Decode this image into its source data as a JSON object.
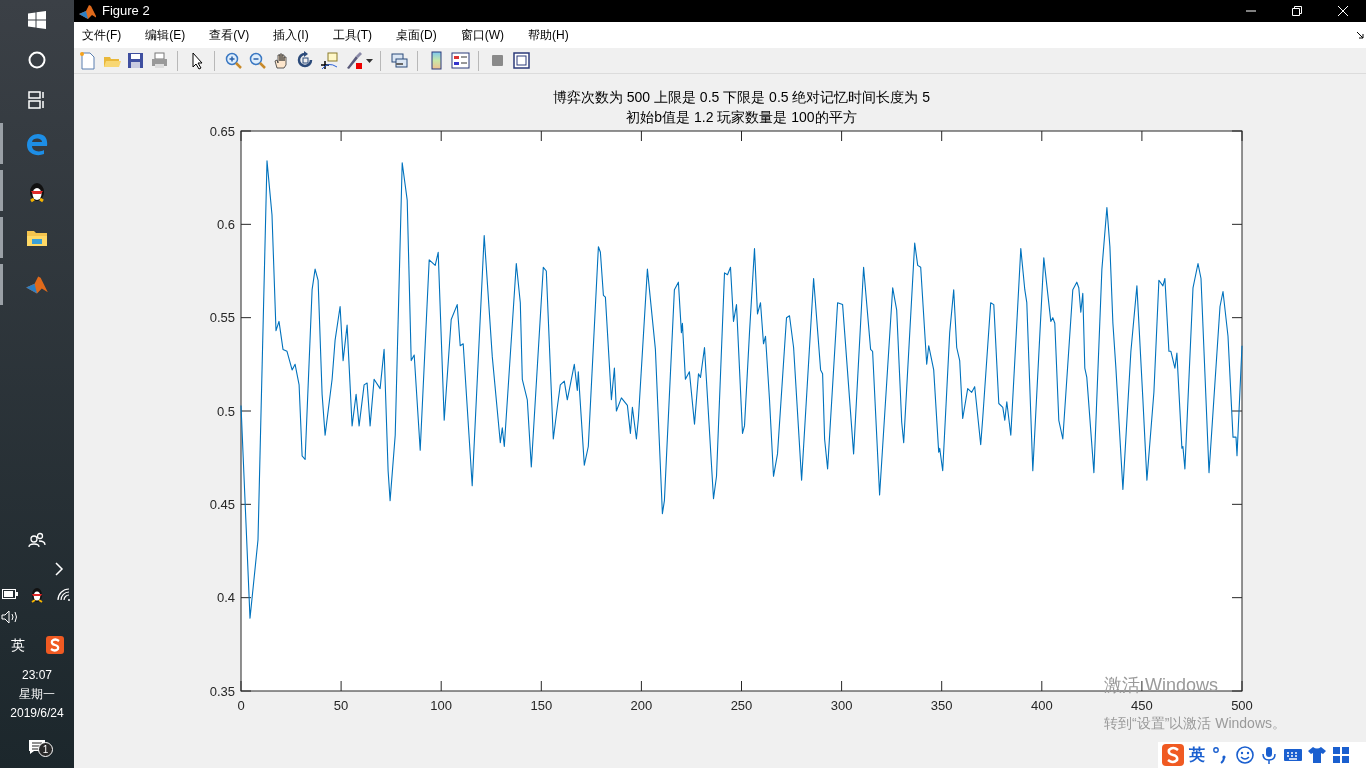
{
  "taskbar": {
    "pinned": [
      {
        "running": true
      },
      {
        "running": true
      },
      {
        "running": true
      },
      {
        "running": true
      }
    ],
    "ime": "英",
    "clock": {
      "time": "23:07",
      "weekday": "星期一",
      "date": "2019/6/24"
    },
    "notification_count": "1"
  },
  "window": {
    "title": "Figure 2",
    "menu": [
      "文件(F)",
      "编辑(E)",
      "查看(V)",
      "插入(I)",
      "工具(T)",
      "桌面(D)",
      "窗口(W)",
      "帮助(H)"
    ]
  },
  "figure": {
    "chart_data": {
      "type": "line",
      "title": "博弈次数为 500 上限是 0.5 下限是 0.5 绝对记忆时间长度为 5\n初始b值是 1.2 玩家数量是 100的平方",
      "xlim": [
        0,
        500
      ],
      "ylim": [
        0.35,
        0.65
      ],
      "xticks": [
        0,
        50,
        100,
        150,
        200,
        250,
        300,
        350,
        400,
        450,
        500
      ],
      "yticks": [
        0.35,
        0.4,
        0.45,
        0.5,
        0.55,
        0.6,
        0.65
      ],
      "x": [
        0,
        4.5,
        8.5,
        13,
        15.5,
        17.5,
        19,
        21,
        23,
        25.5,
        27,
        29,
        30.5,
        32,
        35.5,
        37,
        38.5,
        40.5,
        42,
        45.5,
        47,
        49.5,
        51,
        53,
        55.5,
        57.5,
        59,
        61.5,
        63,
        64.5,
        66.5,
        69.5,
        71.5,
        73.5,
        74.5,
        77,
        80.5,
        83,
        85,
        86.5,
        89.5,
        94,
        97,
        98.5,
        101.5,
        105,
        108,
        109.5,
        111,
        115.5,
        121.5,
        125.5,
        129.5,
        130.5,
        131.5,
        137.5,
        139.5,
        140.5,
        143,
        145,
        151,
        152.5,
        156,
        158,
        159.5,
        161.5,
        163,
        166.5,
        168,
        168.5,
        171.5,
        173.5,
        178.5,
        179.5,
        181,
        182,
        185,
        186.5,
        187.5,
        190,
        193,
        194.5,
        195.5,
        197.5,
        198.5,
        203,
        207,
        210.5,
        211.5,
        216.5,
        218.5,
        220,
        220.5,
        222,
        224,
        226.5,
        228.5,
        229.5,
        231.5,
        236,
        237.5,
        241.5,
        243,
        244.5,
        246,
        247.5,
        250.5,
        251.5,
        254,
        256.5,
        258,
        259.5,
        261,
        262,
        264,
        266,
        268,
        272.5,
        274,
        276,
        280,
        286,
        289.5,
        290.5,
        291.5,
        293,
        298,
        300.5,
        306,
        311,
        314.5,
        315.5,
        319,
        325.5,
        327.5,
        330,
        331,
        336.5,
        338,
        339.5,
        342.5,
        343.5,
        346,
        348.5,
        349,
        350.5,
        354,
        356,
        357.5,
        359,
        360.5,
        363,
        365,
        366.5,
        369.5,
        370.5,
        374.5,
        376,
        378.5,
        380.5,
        381.5,
        382.5,
        384.5,
        389.5,
        391.5,
        392.5,
        395.5,
        401,
        404.5,
        405.5,
        406.5,
        408.5,
        410.5,
        415.5,
        417.5,
        418.5,
        419.5,
        420.5,
        421.5,
        422.5,
        426,
        430,
        432.5,
        434,
        435.5,
        437,
        440.5,
        444.5,
        447.5,
        450.5,
        452.5,
        456,
        458.5,
        460.5,
        461.5,
        463.5,
        464.5,
        466.5,
        467.5,
        470,
        470.5,
        471.5,
        475.5,
        478,
        479.5,
        483.5,
        489,
        490.5,
        493,
        495.5,
        497,
        497.5,
        500
      ],
      "series": [
        {
          "color": "#0072bd",
          "values": [
            0.503,
            0.389,
            0.431,
            0.634,
            0.605,
            0.543,
            0.548,
            0.533,
            0.532,
            0.522,
            0.525,
            0.514,
            0.476,
            0.474,
            0.565,
            0.576,
            0.57,
            0.509,
            0.487,
            0.517,
            0.538,
            0.556,
            0.527,
            0.546,
            0.492,
            0.509,
            0.492,
            0.514,
            0.515,
            0.492,
            0.517,
            0.512,
            0.533,
            0.468,
            0.452,
            0.487,
            0.633,
            0.613,
            0.527,
            0.53,
            0.479,
            0.581,
            0.578,
            0.585,
            0.495,
            0.549,
            0.557,
            0.535,
            0.536,
            0.46,
            0.594,
            0.529,
            0.483,
            0.491,
            0.481,
            0.579,
            0.558,
            0.517,
            0.506,
            0.47,
            0.577,
            0.575,
            0.485,
            0.502,
            0.514,
            0.516,
            0.506,
            0.525,
            0.511,
            0.521,
            0.471,
            0.481,
            0.588,
            0.585,
            0.562,
            0.561,
            0.506,
            0.523,
            0.5,
            0.507,
            0.503,
            0.488,
            0.502,
            0.485,
            0.496,
            0.576,
            0.533,
            0.445,
            0.452,
            0.565,
            0.569,
            0.542,
            0.547,
            0.517,
            0.521,
            0.493,
            0.52,
            0.518,
            0.534,
            0.453,
            0.465,
            0.574,
            0.573,
            0.577,
            0.548,
            0.557,
            0.488,
            0.492,
            0.542,
            0.587,
            0.552,
            0.558,
            0.536,
            0.54,
            0.506,
            0.465,
            0.477,
            0.55,
            0.551,
            0.534,
            0.463,
            0.571,
            0.522,
            0.52,
            0.485,
            0.469,
            0.558,
            0.557,
            0.477,
            0.577,
            0.533,
            0.532,
            0.455,
            0.566,
            0.554,
            0.494,
            0.483,
            0.59,
            0.578,
            0.577,
            0.525,
            0.535,
            0.522,
            0.478,
            0.48,
            0.468,
            0.542,
            0.565,
            0.534,
            0.527,
            0.496,
            0.512,
            0.51,
            0.513,
            0.482,
            0.496,
            0.558,
            0.557,
            0.504,
            0.502,
            0.495,
            0.505,
            0.487,
            0.587,
            0.565,
            0.558,
            0.468,
            0.582,
            0.548,
            0.55,
            0.547,
            0.495,
            0.485,
            0.565,
            0.569,
            0.566,
            0.553,
            0.563,
            0.523,
            0.518,
            0.467,
            0.576,
            0.609,
            0.588,
            0.547,
            0.523,
            0.458,
            0.532,
            0.567,
            0.506,
            0.463,
            0.51,
            0.57,
            0.567,
            0.571,
            0.532,
            0.532,
            0.523,
            0.531,
            0.48,
            0.481,
            0.469,
            0.566,
            0.579,
            0.571,
            0.467,
            0.556,
            0.564,
            0.54,
            0.486,
            0.486,
            0.476,
            0.535
          ]
        }
      ]
    }
  },
  "ime_bar": {
    "language": "英"
  },
  "activation_notice": {
    "title": "激活 Windows",
    "text": "转到“设置”以激活 Windows。"
  }
}
